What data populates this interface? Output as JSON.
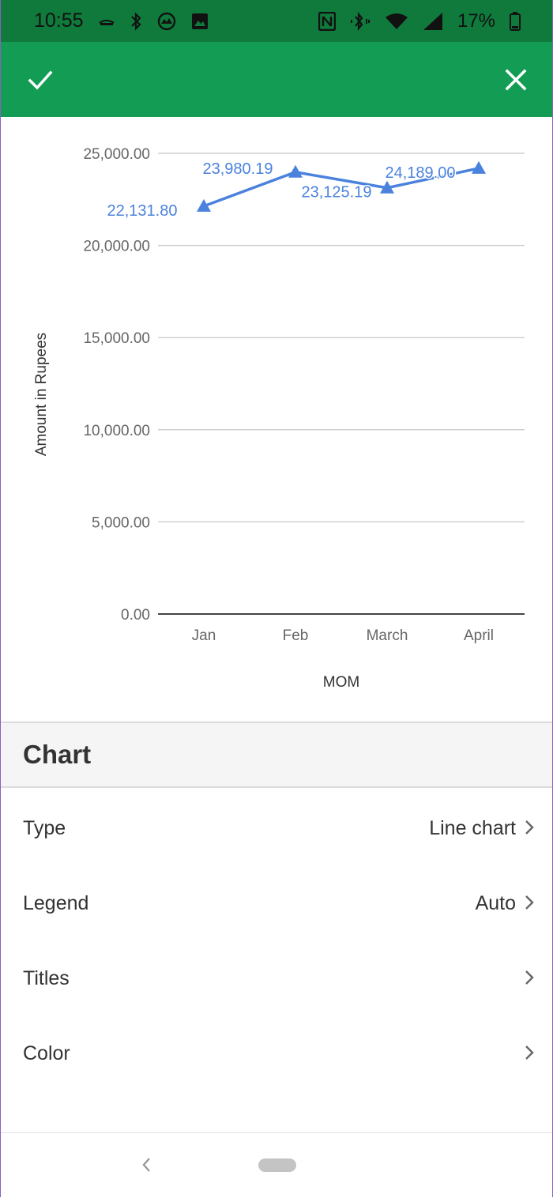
{
  "status_bar": {
    "time": "10:55",
    "battery": "17%",
    "left_icons": [
      "notification-icon",
      "bluetooth-icon",
      "app-icon",
      "image-icon"
    ],
    "right_icons": [
      "nfc-icon",
      "bluetooth-vibrate-icon",
      "wifi-icon",
      "signal-icon",
      "battery-icon"
    ]
  },
  "app_bar": {
    "confirm_icon": "check-icon",
    "close_icon": "close-icon",
    "background_color": "#139c53"
  },
  "chart_data": {
    "type": "line",
    "categories": [
      "Jan",
      "Feb",
      "March",
      "April"
    ],
    "series": [
      {
        "values": [
          22131.8,
          23980.19,
          23125.19,
          24189.0
        ],
        "marker": "triangle",
        "color": "#4a82dd"
      }
    ],
    "data_labels": [
      "22,131.80",
      "23,980.19",
      "23,125.19",
      "24,189.00"
    ],
    "y_ticks": [
      "0.00",
      "5,000.00",
      "10,000.00",
      "15,000.00",
      "20,000.00",
      "25,000.00"
    ],
    "xlabel": "MOM",
    "ylabel": "Amount in Rupees",
    "ylim": [
      0,
      25000
    ],
    "grid": true,
    "legend": "none"
  },
  "section": {
    "title": "Chart"
  },
  "settings": [
    {
      "label": "Type",
      "value": "Line chart"
    },
    {
      "label": "Legend",
      "value": "Auto"
    },
    {
      "label": "Titles",
      "value": ""
    },
    {
      "label": "Color",
      "value": ""
    }
  ]
}
